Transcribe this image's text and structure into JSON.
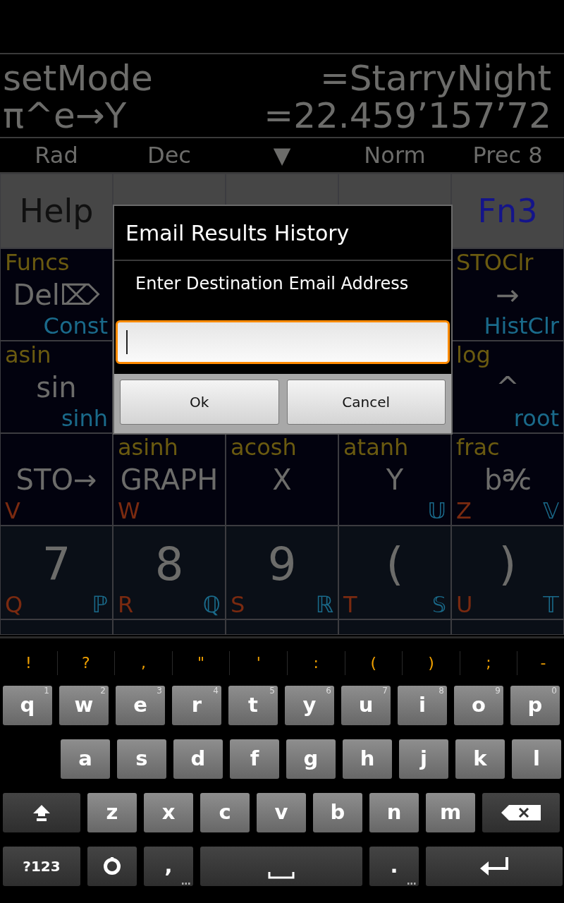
{
  "display": {
    "lines": [
      {
        "expression": "setMode",
        "result": "=StarryNight"
      },
      {
        "expression": "π^e→Y",
        "result": "=22.459’157’72"
      }
    ]
  },
  "mode_bar": [
    "Rad",
    "Dec",
    "▼",
    "Norm",
    "Prec 8"
  ],
  "keypad": {
    "rows": [
      [
        {
          "label": "Help",
          "color": "#101010"
        },
        null,
        null,
        null,
        {
          "label": "Fn3",
          "color": "#14148a"
        }
      ],
      [
        {
          "top": "Funcs",
          "label": "Del⌦",
          "alt": "Const"
        },
        null,
        null,
        null,
        {
          "top": "STOClr",
          "label": "→",
          "alt": "HistClr"
        }
      ],
      [
        {
          "top": "asin",
          "label": "sin",
          "alt": "sinh"
        },
        null,
        null,
        null,
        {
          "top": "log",
          "label": "^",
          "alt": "root"
        }
      ],
      [
        {
          "label": "STO→",
          "alpha": "V"
        },
        {
          "top": "asinh",
          "label": "GRAPH",
          "alpha": "W"
        },
        {
          "top": "acosh",
          "label": "X"
        },
        {
          "top": "atanh",
          "label": "Y",
          "alt": "𝕌"
        },
        {
          "top": "frac",
          "label": "b℀",
          "alpha": "Z",
          "alt": "𝕍"
        }
      ],
      [
        {
          "label": "7",
          "alpha": "Q",
          "alt": "ℙ"
        },
        {
          "label": "8",
          "alpha": "R",
          "alt": "ℚ"
        },
        {
          "label": "9",
          "alpha": "S",
          "alt": "ℝ"
        },
        {
          "label": "(",
          "alpha": "T",
          "alt": "𝕊"
        },
        {
          "label": ")",
          "alpha": "U",
          "alt": "𝕋"
        }
      ]
    ]
  },
  "dialog": {
    "title": "Email Results History",
    "message": "Enter Destination Email Address",
    "buttons": [
      "Ok",
      "Cancel"
    ]
  },
  "keyboard": {
    "suggestions": [
      "!",
      "?",
      ",",
      "\"",
      "'",
      ":",
      "(",
      ")",
      ";",
      "-"
    ],
    "rows": [
      {
        "keys": [
          {
            "kind": "letter",
            "label": "q",
            "hint": "1"
          },
          {
            "kind": "letter",
            "label": "w",
            "hint": "2"
          },
          {
            "kind": "letter",
            "label": "e",
            "hint": "3"
          },
          {
            "kind": "letter",
            "label": "r",
            "hint": "4"
          },
          {
            "kind": "letter",
            "label": "t",
            "hint": "5"
          },
          {
            "kind": "letter",
            "label": "y",
            "hint": "6"
          },
          {
            "kind": "letter",
            "label": "u",
            "hint": "7"
          },
          {
            "kind": "letter",
            "label": "i",
            "hint": "8"
          },
          {
            "kind": "letter",
            "label": "o",
            "hint": "9"
          },
          {
            "kind": "letter",
            "label": "p",
            "hint": "0"
          }
        ]
      },
      {
        "keys": [
          {
            "kind": "letter",
            "label": "a"
          },
          {
            "kind": "letter",
            "label": "s"
          },
          {
            "kind": "letter",
            "label": "d"
          },
          {
            "kind": "letter",
            "label": "f"
          },
          {
            "kind": "letter",
            "label": "g"
          },
          {
            "kind": "letter",
            "label": "h"
          },
          {
            "kind": "letter",
            "label": "j"
          },
          {
            "kind": "letter",
            "label": "k"
          },
          {
            "kind": "letter",
            "label": "l"
          }
        ]
      },
      {
        "keys": [
          {
            "kind": "shift"
          },
          {
            "kind": "letter",
            "label": "z"
          },
          {
            "kind": "letter",
            "label": "x"
          },
          {
            "kind": "letter",
            "label": "c"
          },
          {
            "kind": "letter",
            "label": "v"
          },
          {
            "kind": "letter",
            "label": "b"
          },
          {
            "kind": "letter",
            "label": "n"
          },
          {
            "kind": "letter",
            "label": "m"
          },
          {
            "kind": "backspace"
          }
        ]
      },
      {
        "keys": [
          {
            "kind": "symbols",
            "label": "?123"
          },
          {
            "kind": "settings"
          },
          {
            "kind": "punct",
            "label": ","
          },
          {
            "kind": "space"
          },
          {
            "kind": "punct",
            "label": "."
          },
          {
            "kind": "enter"
          }
        ]
      }
    ]
  }
}
